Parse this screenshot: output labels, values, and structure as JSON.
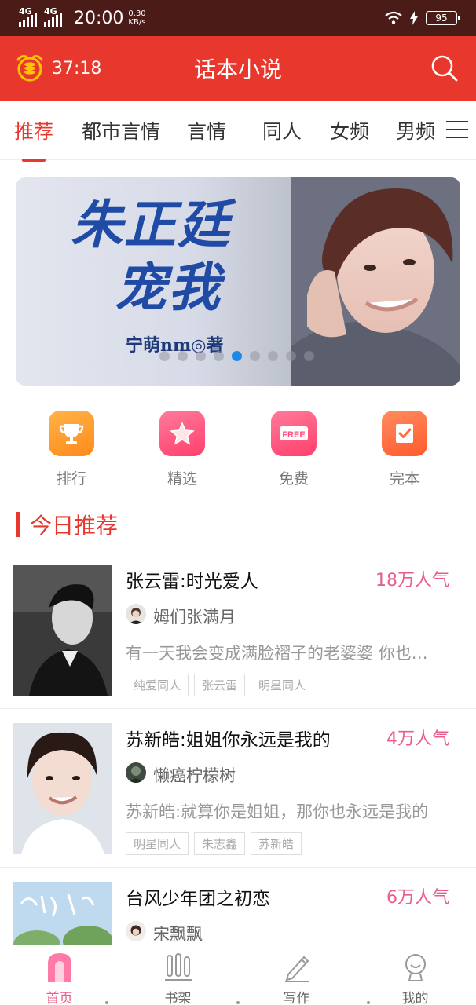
{
  "status_bar": {
    "network_1": "4G",
    "network_2": "4G",
    "time": "20:00",
    "speed_value": "0.30",
    "speed_unit": "KB/s",
    "battery": "95"
  },
  "app_bar": {
    "timer": "37:18",
    "title": "话本小说",
    "alarm_icon": "alarm-clock-icon",
    "search_icon": "search-icon",
    "accent_color": "#e8372d"
  },
  "tabs": [
    {
      "label": "推荐",
      "active": true
    },
    {
      "label": "都市言情",
      "active": false
    },
    {
      "label": "言情",
      "active": false
    },
    {
      "label": "同人",
      "active": false
    },
    {
      "label": "女频",
      "active": false
    },
    {
      "label": "男频",
      "active": false
    }
  ],
  "banner": {
    "title_line1": "朱正廷",
    "title_line2": "宠我",
    "author": "宁萌nm◎著",
    "slide_count": 9,
    "active_slide": 5
  },
  "entries": [
    {
      "label": "排行",
      "icon": "trophy-icon",
      "color": "#ff9a2e"
    },
    {
      "label": "精选",
      "icon": "star-icon",
      "color": "#ff4f7a"
    },
    {
      "label": "免费",
      "icon": "free-tag-icon",
      "color": "#ff4f7a"
    },
    {
      "label": "完本",
      "icon": "check-book-icon",
      "color": "#ff6b3d"
    }
  ],
  "section": {
    "title": "今日推荐"
  },
  "books": [
    {
      "title": "张云雷:时光爱人",
      "popularity": "18万人气",
      "author": "姆们张满月",
      "desc": "有一天我会变成满脸褶子的老婆婆 你也…",
      "tags": [
        "纯爱同人",
        "张云雷",
        "明星同人"
      ]
    },
    {
      "title": "苏新皓:姐姐你永远是我的",
      "popularity": "4万人气",
      "author": "懒癌柠檬树",
      "desc": "苏新皓:就算你是姐姐，那你也永远是我的",
      "tags": [
        "明星同人",
        "朱志鑫",
        "苏新皓"
      ]
    },
    {
      "title": "台风少年团之初恋",
      "popularity": "6万人气",
      "author": "宋飘飘",
      "desc": "",
      "tags": []
    }
  ],
  "bottom_nav": [
    {
      "label": "首页",
      "icon": "home-icon",
      "active": true
    },
    {
      "label": "书架",
      "icon": "bookshelf-icon",
      "active": false
    },
    {
      "label": "写作",
      "icon": "pencil-icon",
      "active": false
    },
    {
      "label": "我的",
      "icon": "profile-icon",
      "active": false
    }
  ]
}
